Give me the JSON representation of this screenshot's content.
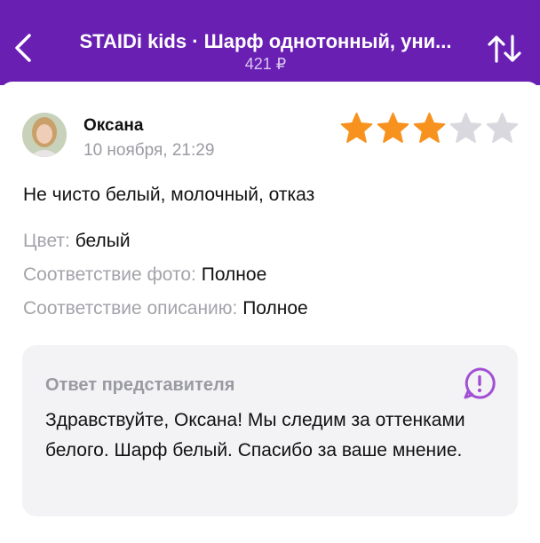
{
  "header": {
    "title": "STAIDi kids · Шарф однотонный, уни...",
    "price": "421 ₽",
    "background": "#6a1fb3",
    "back_icon": "chevron-left-icon",
    "sort_icon": "sort-arrows-icon"
  },
  "review": {
    "author": "Оксана",
    "date": "10 ноября, 21:29",
    "rating": 3,
    "rating_max": 5,
    "text": "Не чисто белый, молочный, отказ",
    "attributes": [
      {
        "key": "Цвет:",
        "value": "белый"
      },
      {
        "key": "Соответствие фото:",
        "value": "Полное"
      },
      {
        "key": "Соответствие описанию:",
        "value": "Полное"
      }
    ]
  },
  "reply": {
    "title": "Ответ представителя",
    "icon": "report-icon",
    "text": "Здравствуйте, Оксана! Мы следим за оттенками белого. Шарф белый. Спасибо за ваше мнение."
  },
  "colors": {
    "star_filled": "#f7921e",
    "star_empty": "#d8d8de",
    "accent": "#a24fd4"
  }
}
